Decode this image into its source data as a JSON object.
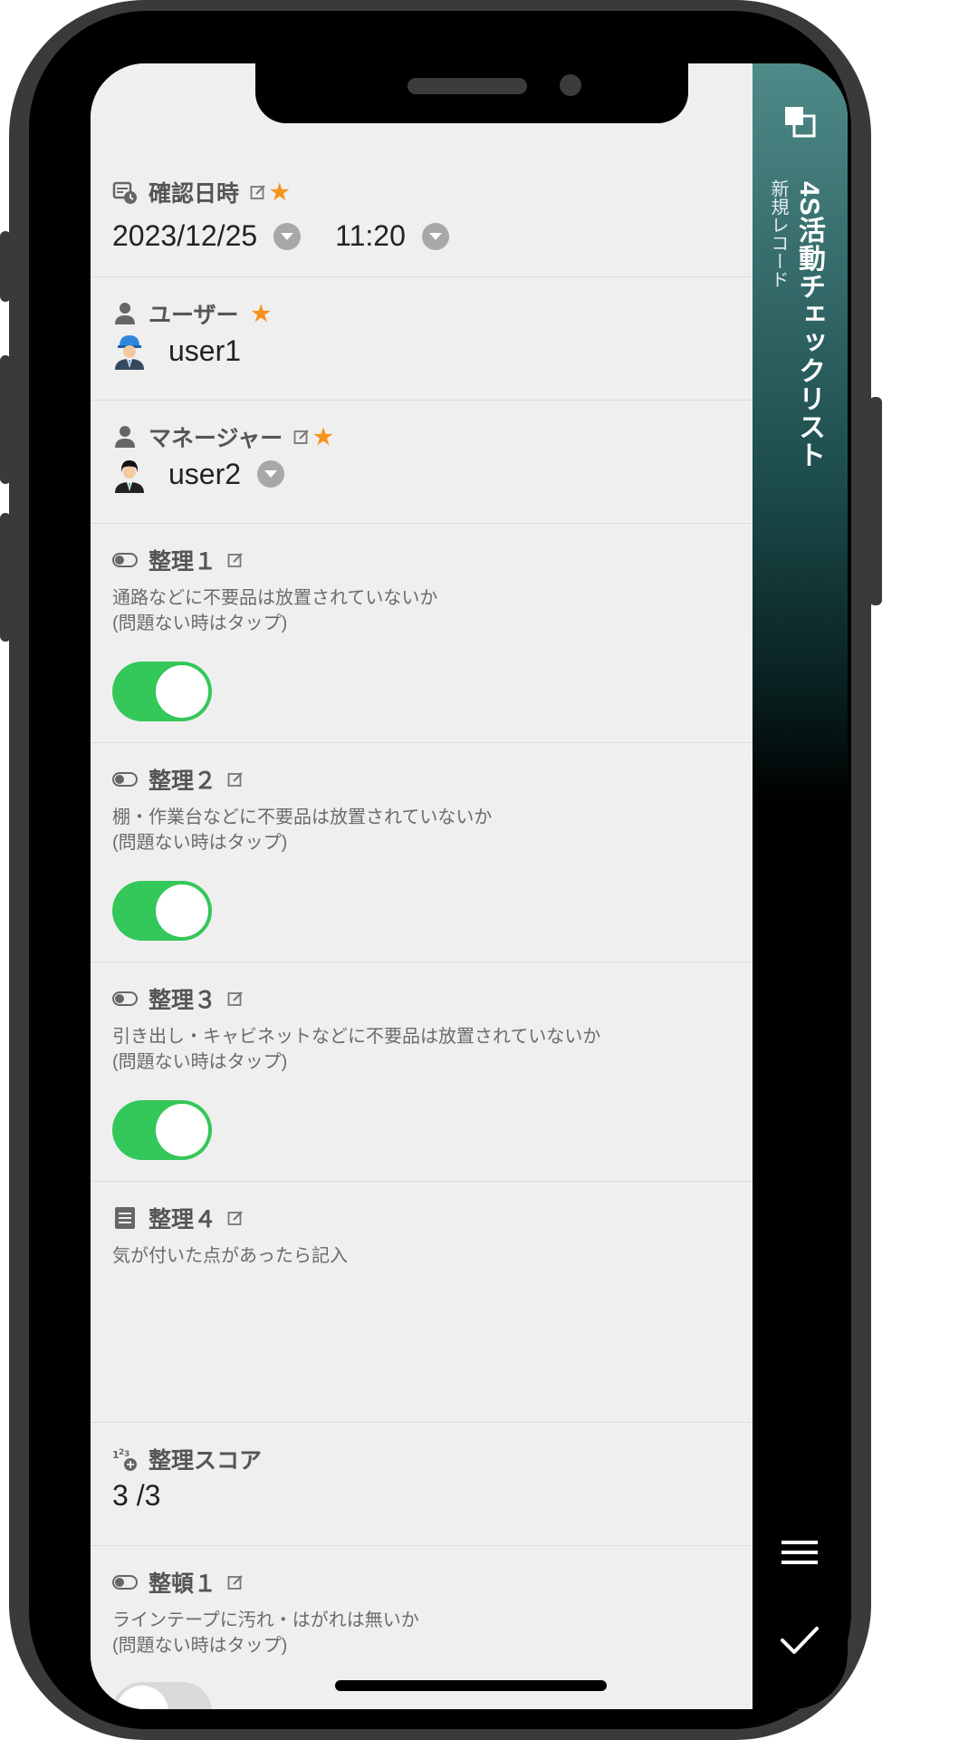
{
  "app": {
    "title": "4S活動チェックリスト",
    "subtitle": "新規レコード"
  },
  "fields": {
    "check_datetime": {
      "label": "確認日時",
      "required_mark": "★",
      "date": "2023/12/25",
      "time": "11:20"
    },
    "user": {
      "label": "ユーザー",
      "required_mark": "★",
      "value": "user1"
    },
    "manager": {
      "label": "マネージャー",
      "required_mark": "★",
      "value": "user2"
    },
    "seiri1": {
      "label": "整理１",
      "desc1": "通路などに不要品は放置されていないか",
      "desc2": "(問題ない時はタップ)",
      "on": true
    },
    "seiri2": {
      "label": "整理２",
      "desc1": "棚・作業台などに不要品は放置されていないか",
      "desc2": "(問題ない時はタップ)",
      "on": true
    },
    "seiri3": {
      "label": "整理３",
      "desc1": "引き出し・キャビネットなどに不要品は放置されていないか",
      "desc2": "(問題ない時はタップ)",
      "on": true
    },
    "seiri4": {
      "label": "整理４",
      "placeholder": "気が付いた点があったら記入"
    },
    "seiri_score": {
      "label": "整理スコア",
      "value": "3 /3"
    },
    "seiton1": {
      "label": "整頓１",
      "desc1": "ラインテープに汚れ・はがれは無いか",
      "desc2": "(問題ない時はタップ)",
      "on": false
    }
  },
  "icons": {
    "window": "window-icon",
    "menu": "hamburger-menu-icon",
    "save": "checkmark-icon"
  },
  "colors": {
    "toggle_on": "#34c759",
    "required": "#f7941d",
    "sidebar_top": "#4e8a88"
  }
}
